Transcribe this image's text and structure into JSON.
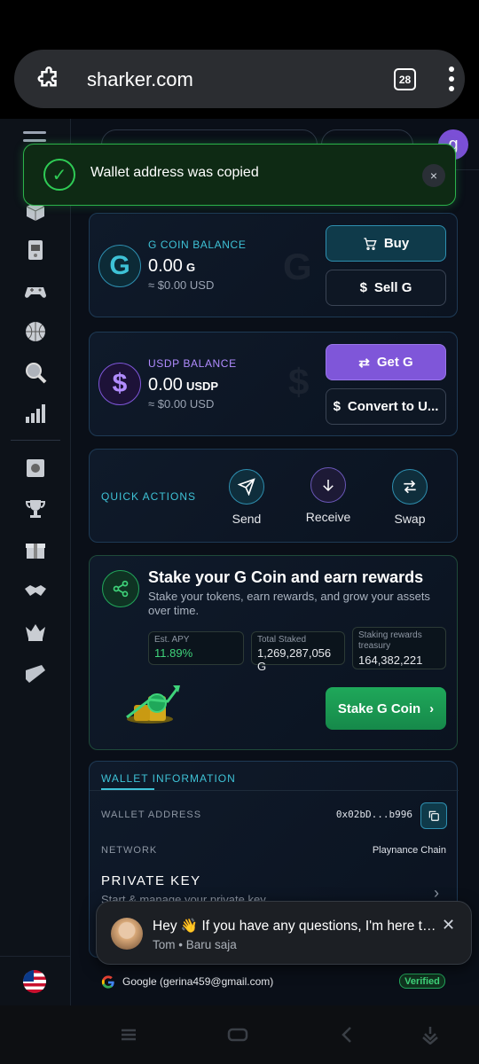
{
  "browser": {
    "url": "sharker.com",
    "tab_count": "28"
  },
  "toast": {
    "message": "Wallet address was copied",
    "close": "×"
  },
  "gcoin": {
    "label": "G COIN BALANCE",
    "symbol": "G",
    "amount": "0.00",
    "unit": "G",
    "usd": "≈ $0.00 USD",
    "buy": "Buy",
    "sell": "Sell G"
  },
  "usdp": {
    "label": "USDP BALANCE",
    "symbol": "$",
    "amount": "0.00",
    "unit": "USDP",
    "usd": "≈ $0.00 USD",
    "get": "Get G",
    "convert": "Convert to U..."
  },
  "quick_actions": {
    "label": "QUICK ACTIONS",
    "items": [
      {
        "label": "Send"
      },
      {
        "label": "Receive"
      },
      {
        "label": "Swap"
      }
    ]
  },
  "stake": {
    "title": "Stake your G Coin and earn rewards",
    "subtitle": "Stake your tokens, earn rewards, and grow your assets over time.",
    "stats": [
      {
        "key": "Est. APY",
        "value": "11.89%"
      },
      {
        "key": "Total Staked",
        "value": "1,269,287,056 G"
      },
      {
        "key": "Staking rewards treasury",
        "value": "164,382,221"
      }
    ],
    "button": "Stake G Coin"
  },
  "wallet_info": {
    "tab": "WALLET INFORMATION",
    "address_label": "WALLET ADDRESS",
    "address": "0x02bD...b996",
    "network_label": "NETWORK",
    "network": "Playnance Chain",
    "private_key": "PRIVATE KEY",
    "private_key_sub": "Start & manage your private key"
  },
  "account": {
    "google": "Google (gerina459@gmail.com)",
    "verified": "Verified"
  },
  "chat": {
    "message": "Hey 👋 If you have any questions, I'm here to help!",
    "sender": "Tom • Baru saja"
  },
  "colors": {
    "accent": "#3ec2d6",
    "purple": "#7f56d9",
    "green": "#1fa85a",
    "toast": "#2bb24a"
  }
}
